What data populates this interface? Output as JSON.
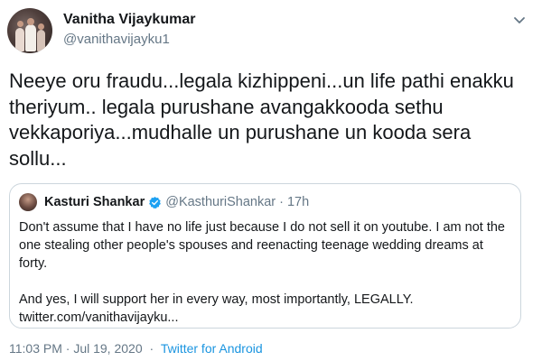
{
  "tweet": {
    "author_name": "Vanitha Vijaykumar",
    "author_handle": "@vanithavijayku1",
    "text": "Neeye oru fraudu...legala kizhippeni...un life pathi enakku theriyum.. legala purushane avangakkooda sethu vekkaporiya...mudhalle un purushane un kooda sera sollu...",
    "timestamp": "11:03 PM · Jul 19, 2020",
    "separator": "·",
    "source": "Twitter for Android",
    "source_color": "#1b95e0"
  },
  "quoted": {
    "author_name": "Kasturi Shankar",
    "author_handle": "@KasthuriShankar",
    "time_separator": "·",
    "time": "17h",
    "verified_color": "#1da1f2",
    "paragraph1": "Don't assume that I have no life just because I do not sell it on youtube. I am not the one stealing other people's  spouses and reenacting teenage wedding dreams at forty.",
    "paragraph2": "And yes, I will support her in every way, most importantly, LEGALLY.",
    "link": "twitter.com/vanithavijayku..."
  },
  "icons": {
    "more": "chevron-down-icon",
    "verified": "verified-badge-icon"
  }
}
